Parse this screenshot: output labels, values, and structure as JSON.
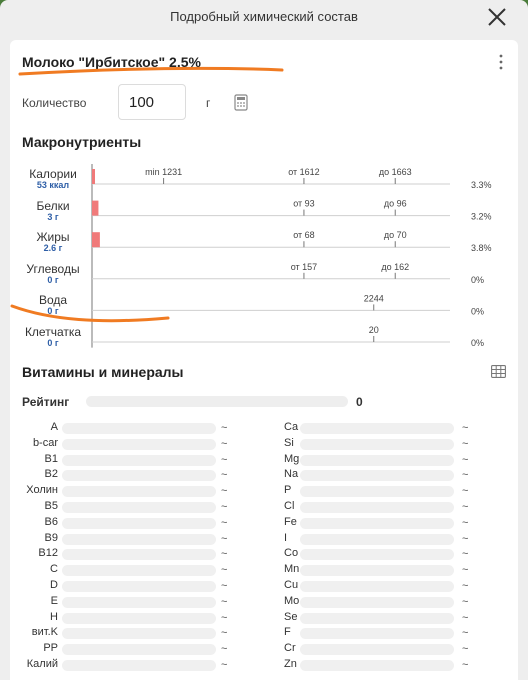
{
  "header": {
    "title": "Подробный химический состав"
  },
  "product": {
    "title": "Молоко \"Ирбитское\" 2.5%"
  },
  "quantity": {
    "label": "Количество",
    "value": "100",
    "unit": "г"
  },
  "macros": {
    "title": "Макронутриенты",
    "items": [
      {
        "name": "Калории",
        "value": "53 ккал",
        "bar_fraction": 0.005,
        "percent": "3.3%",
        "markers": [
          {
            "label": "min 1231",
            "pos": 0.2
          },
          {
            "label": "от 1612",
            "pos": 0.592
          },
          {
            "label": "до 1663",
            "pos": 0.847
          }
        ]
      },
      {
        "name": "Белки",
        "value": "3 г",
        "bar_fraction": 0.018,
        "percent": "3.2%",
        "markers": [
          {
            "label": "от 93",
            "pos": 0.592
          },
          {
            "label": "до 96",
            "pos": 0.847
          }
        ]
      },
      {
        "name": "Жиры",
        "value": "2.6 г",
        "bar_fraction": 0.022,
        "percent": "3.8%",
        "markers": [
          {
            "label": "от 68",
            "pos": 0.592
          },
          {
            "label": "до 70",
            "pos": 0.847
          }
        ]
      },
      {
        "name": "Углеводы",
        "value": "0 г",
        "bar_fraction": 0,
        "percent": "0%",
        "markers": [
          {
            "label": "от 157",
            "pos": 0.592
          },
          {
            "label": "до 162",
            "pos": 0.847
          }
        ]
      },
      {
        "name": "Вода",
        "value": "0 г",
        "bar_fraction": 0,
        "percent": "0%",
        "markers": [
          {
            "label": "2244",
            "pos": 0.787
          }
        ]
      },
      {
        "name": "Клетчатка",
        "value": "0 г",
        "bar_fraction": 0,
        "percent": "0%",
        "markers": [
          {
            "label": "20",
            "pos": 0.787
          }
        ]
      }
    ],
    "bar_color": "#f07a7a"
  },
  "vitamins": {
    "title": "Витамины и минералы",
    "rating_label": "Рейтинг",
    "rating_value": "0",
    "left": [
      {
        "name": "A",
        "value": "~"
      },
      {
        "name": "b-car",
        "value": "~"
      },
      {
        "name": "B1",
        "value": "~"
      },
      {
        "name": "B2",
        "value": "~"
      },
      {
        "name": "Холин",
        "value": "~"
      },
      {
        "name": "B5",
        "value": "~"
      },
      {
        "name": "B6",
        "value": "~"
      },
      {
        "name": "B9",
        "value": "~"
      },
      {
        "name": "B12",
        "value": "~"
      },
      {
        "name": "C",
        "value": "~"
      },
      {
        "name": "D",
        "value": "~"
      },
      {
        "name": "E",
        "value": "~"
      },
      {
        "name": "H",
        "value": "~"
      },
      {
        "name": "вит.K",
        "value": "~"
      },
      {
        "name": "PP",
        "value": "~"
      },
      {
        "name": "Калий",
        "value": "~"
      }
    ],
    "right": [
      {
        "name": "Ca",
        "value": "~"
      },
      {
        "name": "Si",
        "value": "~"
      },
      {
        "name": "Mg",
        "value": "~"
      },
      {
        "name": "Na",
        "value": "~"
      },
      {
        "name": "P",
        "value": "~"
      },
      {
        "name": "Cl",
        "value": "~"
      },
      {
        "name": "Fe",
        "value": "~"
      },
      {
        "name": "I",
        "value": "~"
      },
      {
        "name": "Co",
        "value": "~"
      },
      {
        "name": "Mn",
        "value": "~"
      },
      {
        "name": "Cu",
        "value": "~"
      },
      {
        "name": "Mo",
        "value": "~"
      },
      {
        "name": "Se",
        "value": "~"
      },
      {
        "name": "F",
        "value": "~"
      },
      {
        "name": "Cr",
        "value": "~"
      },
      {
        "name": "Zn",
        "value": "~"
      }
    ]
  },
  "icons": {
    "close": "close-icon",
    "kebab": "kebab-menu-icon",
    "calculator": "calculator-icon",
    "table": "table-icon"
  },
  "colors": {
    "highlight": "#f07b22",
    "value_blue": "#2f5fa7",
    "bar_red": "#f07a7a"
  }
}
